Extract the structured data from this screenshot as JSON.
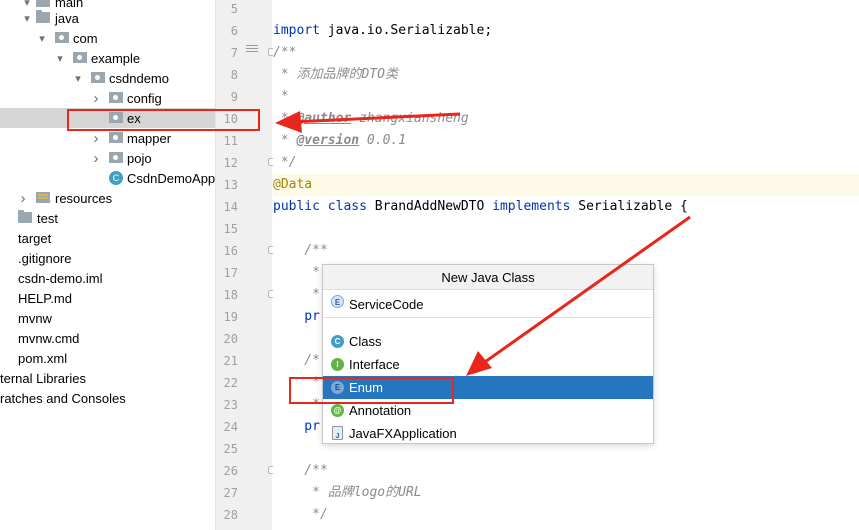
{
  "project_tree": {
    "items": [
      {
        "label": "main",
        "kind": "folder",
        "indent": 1,
        "arrow": "▾"
      },
      {
        "label": "java",
        "kind": "folder",
        "indent": 2,
        "arrow": "▾"
      },
      {
        "label": "com",
        "kind": "package",
        "indent": 3,
        "arrow": "▾"
      },
      {
        "label": "example",
        "kind": "package",
        "indent": 4,
        "arrow": "▾"
      },
      {
        "label": "csdndemo",
        "kind": "package",
        "indent": 5,
        "arrow": "▾"
      },
      {
        "label": "config",
        "kind": "package",
        "indent": 6,
        "arrow": "›"
      },
      {
        "label": "ex",
        "kind": "package",
        "indent": 6,
        "arrow": "",
        "selected": true
      },
      {
        "label": "mapper",
        "kind": "package",
        "indent": 6,
        "arrow": "›"
      },
      {
        "label": "pojo",
        "kind": "package",
        "indent": 6,
        "arrow": "›"
      },
      {
        "label": "CsdnDemoApp",
        "kind": "class",
        "indent": 6,
        "arrow": ""
      },
      {
        "label": "resources",
        "kind": "resources",
        "indent": 2,
        "arrow": "›"
      },
      {
        "label": "test",
        "kind": "folder",
        "indent": 1,
        "arrow": ""
      },
      {
        "label": "target",
        "kind": "file",
        "indent": 0,
        "arrow": ""
      },
      {
        "label": ".gitignore",
        "kind": "file",
        "indent": 0,
        "arrow": ""
      },
      {
        "label": "csdn-demo.iml",
        "kind": "file",
        "indent": 0,
        "arrow": ""
      },
      {
        "label": "HELP.md",
        "kind": "file",
        "indent": 0,
        "arrow": ""
      },
      {
        "label": "mvnw",
        "kind": "file",
        "indent": 0,
        "arrow": ""
      },
      {
        "label": "mvnw.cmd",
        "kind": "file",
        "indent": 0,
        "arrow": ""
      },
      {
        "label": "pom.xml",
        "kind": "file",
        "indent": 0,
        "arrow": ""
      },
      {
        "label": "ternal Libraries",
        "kind": "file",
        "indent": 0,
        "arrow": ""
      },
      {
        "label": "ratches and Consoles",
        "kind": "file",
        "indent": 0,
        "arrow": ""
      }
    ]
  },
  "editor": {
    "line_numbers": [
      "5",
      "6",
      "7",
      "8",
      "9",
      "10",
      "11",
      "12",
      "13",
      "14",
      "15",
      "16",
      "17",
      "18",
      "19",
      "20",
      "21",
      "22",
      "23",
      "24",
      "25",
      "26",
      "27",
      "28"
    ],
    "code": {
      "l6_kw": "import",
      "l6_rest": " java.io.Serializable;",
      "l7": "/**",
      "l8": " * 添加品牌的DTO类",
      "l9": " *",
      "l10_a": " * ",
      "l10_tag": "@author",
      "l10_b": " zhangxiansheng",
      "l11_a": " * ",
      "l11_tag": "@version",
      "l11_b": " 0.0.1",
      "l12": " */",
      "l13": "@Data",
      "l14_kw1": "public class",
      "l14_name": " BrandAddNewDTO ",
      "l14_kw2": "implements",
      "l14_rest": " Serializable {",
      "l16": "    /**",
      "l17": "     *",
      "l18": "     *",
      "l19": "    pr",
      "l21": "    /*",
      "l22": "     *",
      "l23": "     *",
      "l24": "    pr",
      "l26": "    /**",
      "l27": "     * 品牌logo的URL",
      "l28": "     */"
    }
  },
  "popup": {
    "title": "New Java Class",
    "name_value": "ServiceCode",
    "name_icon": "E",
    "kinds": [
      {
        "label": "Class",
        "icon": "C"
      },
      {
        "label": "Interface",
        "icon": "I"
      },
      {
        "label": "Enum",
        "icon": "E",
        "selected": true
      },
      {
        "label": "Annotation",
        "icon": "@"
      },
      {
        "label": "JavaFXApplication",
        "icon": "J"
      }
    ]
  },
  "colors": {
    "selection_blue": "#2675bf",
    "annotation_red": "#e8261c",
    "keyword": "#0033b3",
    "comment": "#8c8c8c"
  }
}
